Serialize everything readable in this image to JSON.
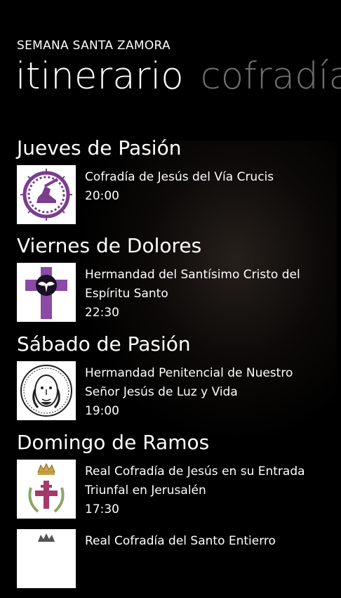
{
  "app": {
    "title": "SEMANA SANTA ZAMORA"
  },
  "pivot": {
    "active": "itinerario",
    "next": "cofradía"
  },
  "days": [
    {
      "day": "Jueves de Pasión",
      "name": "Cofradía de Jesús del Vía Crucis",
      "time": "20:00",
      "icon": "crown-of-thorns-emblem"
    },
    {
      "day": "Viernes de Dolores",
      "name": "Hermandad del Santísimo Cristo del Espíritu Santo",
      "time": "22:30",
      "icon": "purple-cross-dove-emblem"
    },
    {
      "day": "Sábado de Pasión",
      "name": "Hermandad Penitencial de Nuestro Señor Jesús de Luz y Vida",
      "time": "19:00",
      "icon": "christ-face-emblem"
    },
    {
      "day": "Domingo de Ramos",
      "name": "Real Cofradía de Jesús en su Entrada Triunfal en Jerusalén",
      "time": "17:30",
      "icon": "royal-crown-cross-emblem"
    },
    {
      "name": "Real Cofradía del Santo Entierro",
      "icon": "santo-entierro-emblem"
    }
  ]
}
